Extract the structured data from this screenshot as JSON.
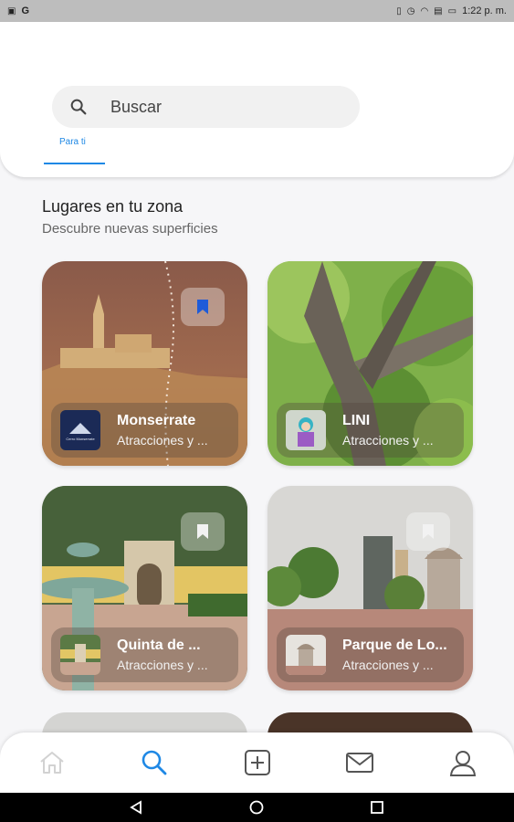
{
  "status_bar": {
    "left": "G",
    "time": "1:22 p. m."
  },
  "search": {
    "placeholder": "Buscar"
  },
  "tabs": [
    {
      "label": "Para ti",
      "active": true
    }
  ],
  "section": {
    "title": "Lugares en tu zona",
    "subtitle": "Descubre nuevas superficies"
  },
  "places": [
    {
      "title": "Monserrate",
      "subtitle": "Atracciones y ...",
      "thumb_text": "Cerro Monserrate",
      "bookmarked": true
    },
    {
      "title": "LINI",
      "subtitle": "Atracciones y ...",
      "bookmarked": false
    },
    {
      "title": "Quinta de ...",
      "subtitle": "Atracciones y ...",
      "bookmarked": false
    },
    {
      "title": "Parque de Lo...",
      "subtitle": "Atracciones y ...",
      "bookmarked": false
    }
  ],
  "bottom_nav": [
    {
      "icon": "home-icon",
      "active": false
    },
    {
      "icon": "search-icon",
      "active": true
    },
    {
      "icon": "add-icon",
      "active": false
    },
    {
      "icon": "mail-icon",
      "active": false
    },
    {
      "icon": "profile-icon",
      "active": false
    }
  ],
  "colors": {
    "accent": "#1e88e5",
    "background": "#f6f6f8"
  }
}
